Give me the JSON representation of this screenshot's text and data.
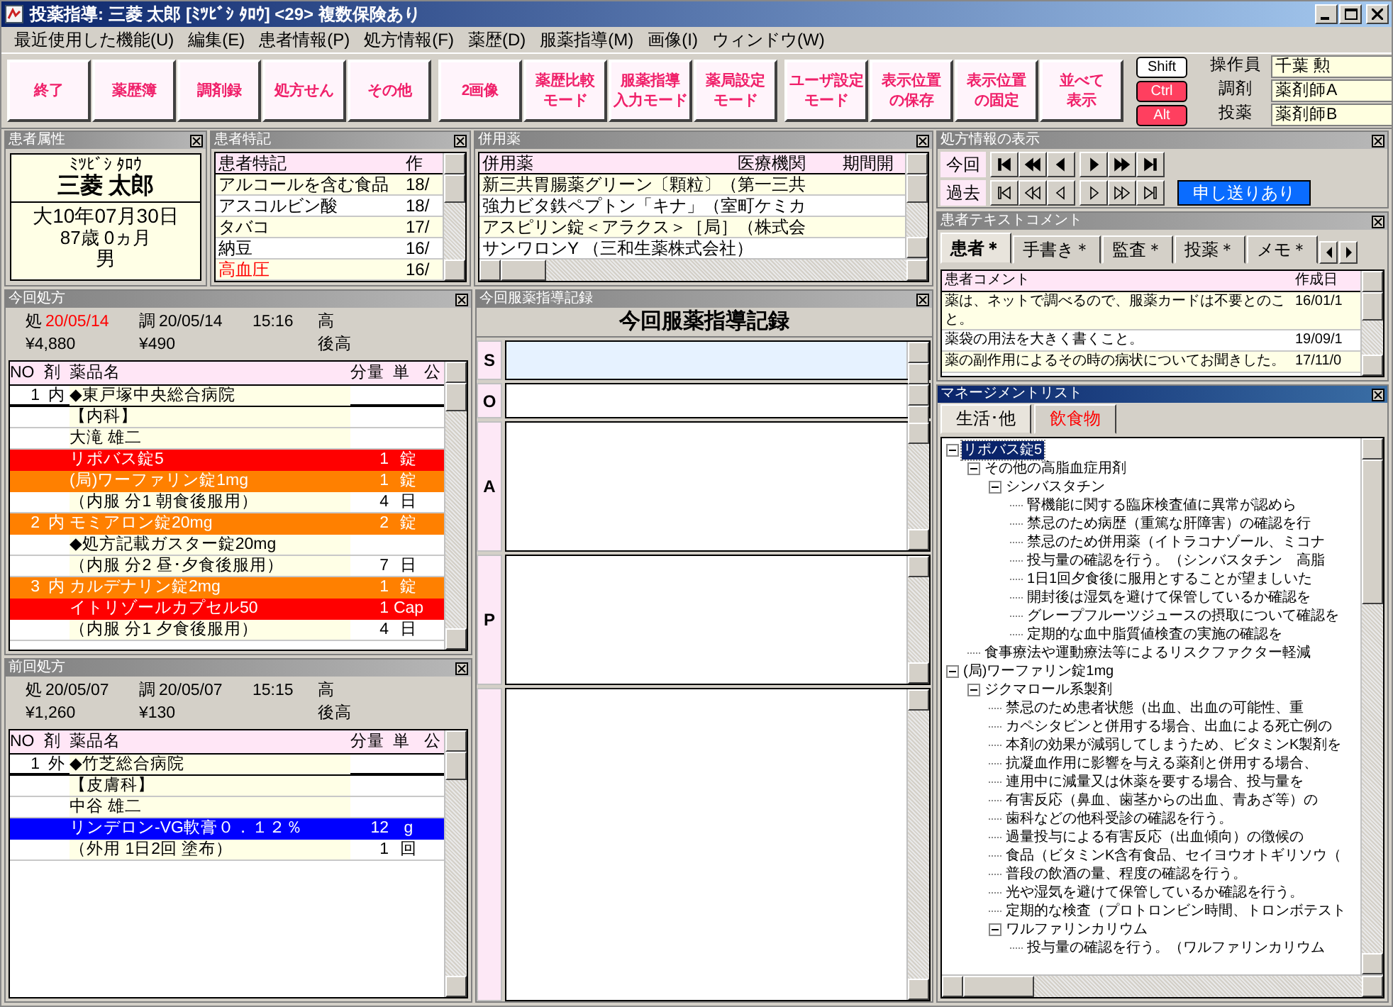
{
  "window": {
    "title": "投薬指導: 三菱 太郎 [ﾐﾂﾋﾞｼ ﾀﾛｳ] <29> 複数保険あり"
  },
  "menu": [
    "最近使用した機能(U)",
    "編集(E)",
    "患者情報(P)",
    "処方情報(F)",
    "薬歴(D)",
    "服薬指導(M)",
    "画像(I)",
    "ウィンドウ(W)"
  ],
  "toolbar": [
    [
      {
        "lines": [
          "終了"
        ]
      },
      {
        "lines": [
          "薬歴簿"
        ]
      },
      {
        "lines": [
          "調剤録"
        ]
      },
      {
        "lines": [
          "処方せん"
        ]
      },
      {
        "lines": [
          "その他"
        ]
      }
    ],
    [
      {
        "lines": [
          "2画像"
        ]
      },
      {
        "lines": [
          "薬歴比較",
          "モード"
        ]
      },
      {
        "lines": [
          "服薬指導",
          "入力モード"
        ]
      },
      {
        "lines": [
          "薬局設定",
          "モード"
        ]
      }
    ],
    [
      {
        "lines": [
          "ユーザ設定",
          "モード"
        ]
      },
      {
        "lines": [
          "表示位置",
          "の保存"
        ]
      },
      {
        "lines": [
          "表示位置",
          "の固定"
        ]
      },
      {
        "lines": [
          "並べて",
          "表示"
        ]
      }
    ]
  ],
  "modifier_keys": [
    {
      "label": "Shift",
      "on": false
    },
    {
      "label": "Ctrl",
      "on": true
    },
    {
      "label": "Alt",
      "on": true
    }
  ],
  "staff": [
    {
      "role": "操作員",
      "name": "千葉 勲"
    },
    {
      "role": "調剤",
      "name": "薬剤師A"
    },
    {
      "role": "投薬",
      "name": "薬剤師B"
    }
  ],
  "patient": {
    "panel_title": "患者属性",
    "kana": "ﾐﾂﾋﾞｼ ﾀﾛｳ",
    "name": "三菱 太郎",
    "birth": "大10年07月30日",
    "age": "87歳 0ヵ月",
    "sex": "男"
  },
  "notes": {
    "panel_title": "患者特記",
    "columns": [
      "患者特記",
      "作"
    ],
    "rows": [
      {
        "text": "アルコールを含む食品",
        "date": "18/",
        "alert": false
      },
      {
        "text": "アスコルビン酸",
        "date": "18/",
        "alert": false
      },
      {
        "text": "タバコ",
        "date": "17/",
        "alert": false
      },
      {
        "text": "納豆",
        "date": "16/",
        "alert": false
      },
      {
        "text": "高血圧",
        "date": "16/",
        "alert": true
      }
    ]
  },
  "concomitant": {
    "panel_title": "併用薬",
    "columns": [
      "併用薬",
      "医療機関",
      "期間開"
    ],
    "rows": [
      "新三共胃腸薬グリーン〔顆粒〕（第一三共",
      "強力ビタ鉄ペプトン「キナ」（室町ケミカ",
      "アスピリン錠＜アラクス＞［局］（株式会",
      "サンワロンY （三和生薬株式会社）"
    ]
  },
  "current_rx": {
    "panel_title": "今回処方",
    "issued_label": "処",
    "issued": "20/05/14",
    "issued_alert": true,
    "dispensed_label": "調",
    "dispensed": "20/05/14",
    "time": "15:16",
    "tier": "高",
    "fee": "¥4,880",
    "copay": "¥490",
    "tier2": "後高",
    "columns": [
      "NO",
      "剤",
      "薬品名",
      "分量",
      "単",
      "公"
    ],
    "rows": [
      {
        "no": "1",
        "form": "内",
        "name": "◆東戸塚中央総合病院",
        "kind": "header",
        "selected": false
      },
      {
        "name": "【内科】",
        "kind": "plain",
        "selected": false
      },
      {
        "name": "大滝 雄二",
        "kind": "plain",
        "selected": false
      },
      {
        "name": "リポバス錠5",
        "qty": "1",
        "unit": "錠",
        "kind": "danger",
        "selected": false
      },
      {
        "name": "(局)ワーファリン錠1mg",
        "qty": "1",
        "unit": "錠",
        "kind": "warn",
        "selected": false
      },
      {
        "name": "（内服 分1 朝食後服用）",
        "qty": "4",
        "unit": "日",
        "kind": "plain",
        "selected": false
      },
      {
        "no": "2",
        "form": "内",
        "name": "モミアロン錠20mg",
        "qty": "2",
        "unit": "錠",
        "kind": "warn",
        "selected": false
      },
      {
        "name": "◆処方記載ガスター錠20mg",
        "kind": "plain",
        "selected": false
      },
      {
        "name": "（内服 分2 昼･夕食後服用）",
        "qty": "7",
        "unit": "日",
        "kind": "plain",
        "selected": false
      },
      {
        "no": "3",
        "form": "内",
        "name": "カルデナリン錠2mg",
        "qty": "1",
        "unit": "錠",
        "kind": "warn",
        "selected": false
      },
      {
        "name": "イトリゾールカプセル50",
        "qty": "1",
        "unit": "Cap",
        "kind": "danger",
        "selected": false
      },
      {
        "name": "（内服 分1 夕食後服用）",
        "qty": "4",
        "unit": "日",
        "kind": "plain",
        "selected": false
      }
    ]
  },
  "previous_rx": {
    "panel_title": "前回処方",
    "issued_label": "処",
    "issued": "20/05/07",
    "issued_alert": false,
    "dispensed_label": "調",
    "dispensed": "20/05/07",
    "time": "15:15",
    "tier": "高",
    "fee": "¥1,260",
    "copay": "¥130",
    "tier2": "後高",
    "columns": [
      "NO",
      "剤",
      "薬品名",
      "分量",
      "単",
      "公"
    ],
    "rows": [
      {
        "no": "1",
        "form": "外",
        "name": "◆竹芝総合病院",
        "kind": "header",
        "selected": false
      },
      {
        "name": "【皮膚科】",
        "kind": "plain",
        "selected": false
      },
      {
        "name": "中谷 雄二",
        "kind": "plain",
        "selected": false
      },
      {
        "name": "リンデロン-VG軟膏０．１２％",
        "qty": "12",
        "unit": "g",
        "kind": "plain",
        "selected": true
      },
      {
        "name": "（外用 1日2回 塗布）",
        "qty": "1",
        "unit": "回",
        "kind": "plain",
        "selected": false
      }
    ]
  },
  "guidance": {
    "panel_title": "今回服薬指導記録",
    "heading": "今回服薬指導記録",
    "sections": [
      {
        "label": "S",
        "focused": true
      },
      {
        "label": "O",
        "focused": false
      },
      {
        "label": "A",
        "focused": false
      },
      {
        "label": "P",
        "focused": false
      }
    ]
  },
  "rx_nav": {
    "panel_title": "処方情報の表示",
    "rows": [
      {
        "label": "今回",
        "filled": true
      },
      {
        "label": "過去",
        "filled": false
      }
    ],
    "notice": "申し送りあり"
  },
  "comments": {
    "panel_title": "患者テキストコメント",
    "tabs": [
      {
        "label": "患者＊",
        "selected": true
      },
      {
        "label": "手書き＊",
        "selected": false
      },
      {
        "label": "監査＊",
        "selected": false
      },
      {
        "label": "投薬＊",
        "selected": false
      },
      {
        "label": "メモ＊",
        "selected": false
      }
    ],
    "columns": [
      "患者コメント",
      "作成日"
    ],
    "rows": [
      {
        "text": "薬は、ネットで調べるので、服薬カードは不要とのこと。",
        "date": "16/01/1"
      },
      {
        "text": "薬袋の用法を大きく書くこと。",
        "date": "19/09/1"
      },
      {
        "text": "薬の副作用によるその時の病状についてお聞きした。",
        "date": "17/11/0"
      }
    ]
  },
  "management_list": {
    "panel_title": "マネージメントリスト",
    "active": true,
    "tabs": [
      {
        "label": "生活･他",
        "selected": true,
        "alert": false
      },
      {
        "label": "飲食物",
        "selected": false,
        "alert": true
      }
    ],
    "tree": [
      {
        "label": "リポバス錠5",
        "selected": true,
        "expanded": true,
        "children": [
          {
            "label": "その他の高脂血症用剤",
            "selected": false,
            "expanded": true,
            "children": [
              {
                "label": "シンバスタチン",
                "selected": false,
                "expanded": true,
                "children": [
                  {
                    "label": "腎機能に関する臨床検査値に異常が認めら",
                    "selected": false
                  },
                  {
                    "label": "禁忌のため病歴（重篤な肝障害）の確認を行",
                    "selected": false
                  },
                  {
                    "label": "禁忌のため併用薬（イトラコナゾール、ミコナ",
                    "selected": false
                  },
                  {
                    "label": "投与量の確認を行う。（シンバスタチン　高脂",
                    "selected": false
                  },
                  {
                    "label": "1日1回夕食後に服用とすることが望ましいた",
                    "selected": false
                  },
                  {
                    "label": "開封後は湿気を避けて保管しているか確認を",
                    "selected": false
                  },
                  {
                    "label": "グレープフルーツジュースの摂取について確認を",
                    "selected": false
                  },
                  {
                    "label": "定期的な血中脂質値検査の実施の確認を",
                    "selected": false
                  }
                ]
              }
            ]
          },
          {
            "label": "食事療法や運動療法等によるリスクファクター軽減",
            "selected": false
          }
        ]
      },
      {
        "label": "(局)ワーファリン錠1mg",
        "selected": false,
        "expanded": true,
        "children": [
          {
            "label": "ジクマロール系製剤",
            "selected": false,
            "expanded": true,
            "children": [
              {
                "label": "禁忌のため患者状態（出血、出血の可能性、重",
                "selected": false
              },
              {
                "label": "カペシタビンと併用する場合、出血による死亡例の",
                "selected": false
              },
              {
                "label": "本剤の効果が減弱してしまうため、ビタミンK製剤を",
                "selected": false
              },
              {
                "label": "抗凝血作用に影響を与える薬剤と併用する場合、",
                "selected": false
              },
              {
                "label": "連用中に減量又は休薬を要する場合、投与量を",
                "selected": false
              },
              {
                "label": "有害反応（鼻血、歯茎からの出血、青あざ等）の",
                "selected": false
              },
              {
                "label": "歯科などの他科受診の確認を行う。",
                "selected": false
              },
              {
                "label": "過量投与による有害反応（出血傾向）の徴候の",
                "selected": false
              },
              {
                "label": "食品（ビタミンK含有食品、セイヨウオトギリソウ（",
                "selected": false
              },
              {
                "label": "普段の飲酒の量、程度の確認を行う。",
                "selected": false
              },
              {
                "label": "光や湿気を避けて保管しているか確認を行う。",
                "selected": false
              },
              {
                "label": "定期的な検査（プロトロンビン時間、トロンボテスト",
                "selected": false
              },
              {
                "label": "ワルファリンカリウム",
                "selected": false,
                "expanded": true,
                "children": [
                  {
                    "label": "投与量の確認を行う。（ワルファリンカリウム",
                    "selected": false
                  }
                ]
              }
            ]
          }
        ]
      }
    ]
  }
}
